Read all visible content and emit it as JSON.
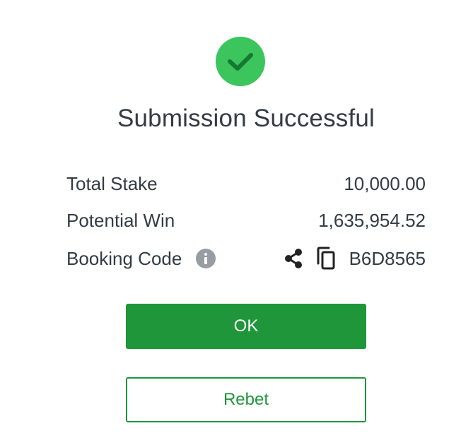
{
  "dialog": {
    "icon": "check-icon",
    "title": "Submission Successful",
    "colors": {
      "success_circle": "#3cc55d",
      "primary_green": "#1e9639",
      "text": "#353a45",
      "info_icon": "#9a9ca3"
    }
  },
  "summary": {
    "total_stake_label": "Total Stake",
    "total_stake_value": "10,000.00",
    "potential_win_label": "Potential Win",
    "potential_win_value": "1,635,954.52",
    "booking_code_label": "Booking Code",
    "booking_code_value": "B6D8565",
    "icons": [
      "info-icon",
      "share-icon",
      "copy-icon"
    ]
  },
  "buttons": {
    "ok_label": "OK",
    "rebet_label": "Rebet"
  }
}
